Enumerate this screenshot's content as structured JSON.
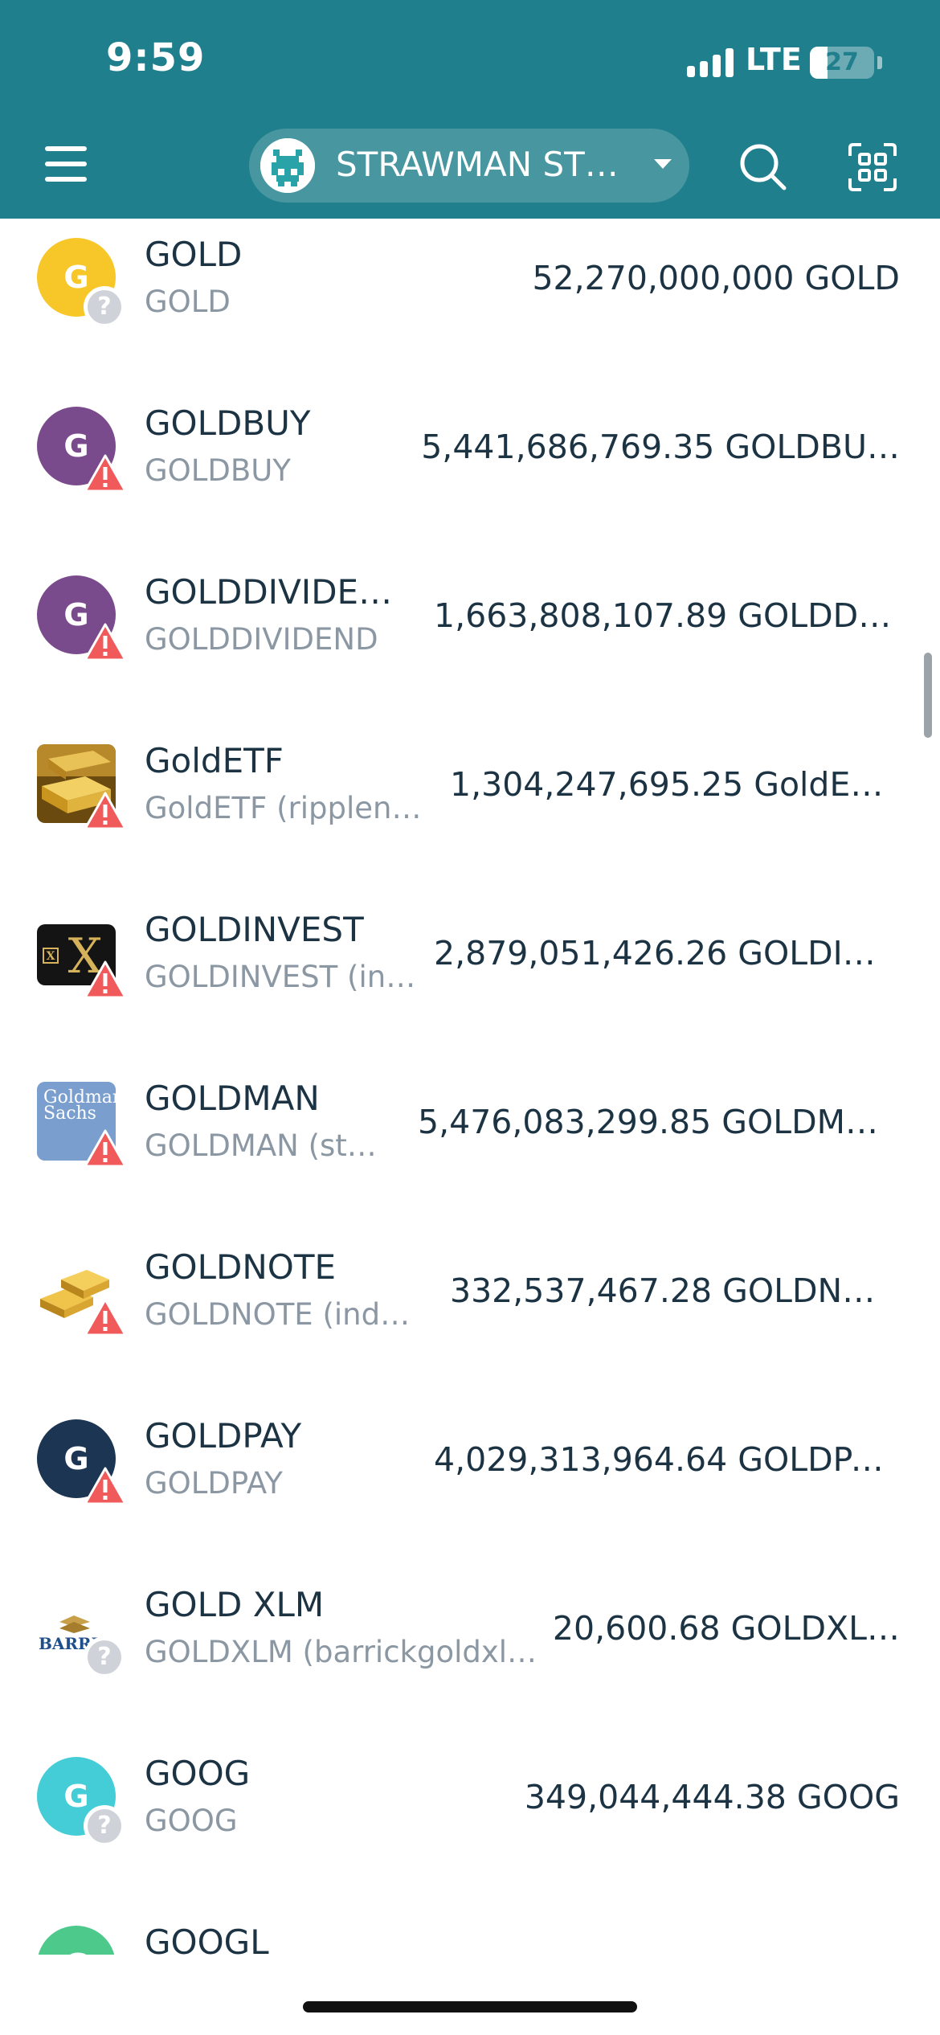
{
  "status_bar": {
    "time": "9:59",
    "network": "LTE",
    "battery": "27",
    "battery_level": 0.27
  },
  "header": {
    "menu_icon": "hamburger-menu-icon",
    "account_name": "STRAWMAN ST…",
    "account_avatar_icon": "pixel-avatar-icon",
    "dropdown_icon": "caret-down-icon",
    "search_icon": "search-icon",
    "scan_icon": "qr-scan-icon",
    "colors": {
      "primary": "#1f7f8c"
    }
  },
  "tokens": [
    {
      "code": "GOLD",
      "name": "GOLD",
      "balance": "52,270,000,000 GOLD",
      "icon_letter": "G",
      "icon_color": "#f7c72a",
      "badge": "unknown"
    },
    {
      "code": "GOLDBUY",
      "name": "GOLDBUY",
      "balance": "5,441,686,769.35 GOLDBU…",
      "icon_letter": "G",
      "icon_color": "#7a4b8c",
      "badge": "warning"
    },
    {
      "code": "GOLDDIVIDE…",
      "name": "GOLDDIVIDEND",
      "balance": "1,663,808,107.89 GOLDDI…",
      "icon_letter": "G",
      "icon_color": "#7a4b8c",
      "badge": "warning"
    },
    {
      "code": "GoldETF",
      "name": "GoldETF (ripplene…",
      "balance": "1,304,247,695.25 GoldET…",
      "icon_image": "gold-bars-image",
      "badge": "warning"
    },
    {
      "code": "GOLDINVEST",
      "name": "GOLDINVEST (in…",
      "balance": "2,879,051,426.26 GOLDIN…",
      "icon_image": "x-logo-image",
      "badge": "warning"
    },
    {
      "code": "GOLDMAN",
      "name": "GOLDMAN (st…",
      "balance": "5,476,083,299.85 GOLDMA…",
      "icon_image": "goldman-sachs-logo-image",
      "icon_logo_text": "Goldman Sachs",
      "badge": "warning"
    },
    {
      "code": "GOLDNOTE",
      "name": "GOLDNOTE (ind…",
      "balance": "332,537,467.28 GOLDNO…",
      "icon_image": "gold-bars-stack-image",
      "badge": "warning"
    },
    {
      "code": "GOLDPAY",
      "name": "GOLDPAY",
      "balance": "4,029,313,964.64 GOLDPA…",
      "icon_letter": "G",
      "icon_color": "#1c3552",
      "badge": "warning"
    },
    {
      "code": "GOLD XLM",
      "name": "GOLDXLM (barrickgoldxl…",
      "balance": "20,600.68 GOLDXL…",
      "icon_image": "barrick-logo-image",
      "icon_logo_text": "BARRI",
      "badge": "unknown"
    },
    {
      "code": "GOOG",
      "name": "GOOG",
      "balance": "349,044,444.38 GOOG",
      "icon_letter": "G",
      "icon_color": "#44cdd6",
      "badge": "unknown"
    },
    {
      "code": "GOOGL",
      "name": "",
      "balance": "",
      "icon_letter": "G",
      "icon_color": "#4cc98b",
      "badge": "none"
    }
  ]
}
